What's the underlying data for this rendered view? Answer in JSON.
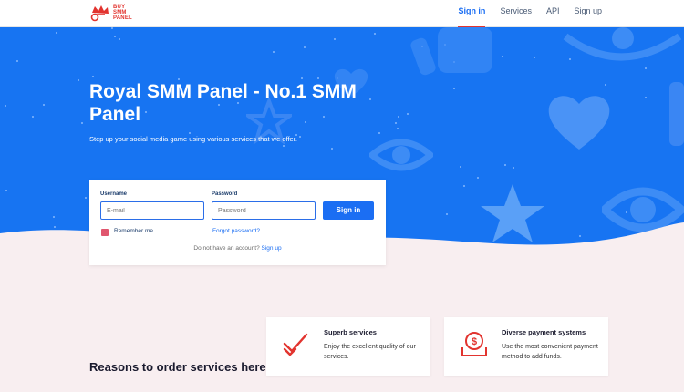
{
  "brand": {
    "logo_text": [
      "BUY",
      "SMM",
      "PANEL"
    ],
    "accent": "#e2342f"
  },
  "nav": {
    "items": [
      {
        "label": "Sign in",
        "active": true
      },
      {
        "label": "Services",
        "active": false
      },
      {
        "label": "API",
        "active": false
      },
      {
        "label": "Sign up",
        "active": false
      }
    ]
  },
  "hero": {
    "title": "Royal SMM Panel - No.1 SMM Panel",
    "subtitle": "Step up your social media game using various services that we offer.",
    "bg_color": "#1774f2"
  },
  "login": {
    "username_label": "Username",
    "username_placeholder": "E-mail",
    "password_label": "Password",
    "password_placeholder": "Password",
    "submit_label": "Sign in",
    "remember_label": "Remember me",
    "forgot_label": "Forgot password?",
    "no_account_text": "Do not have an account?",
    "signup_link": "Sign up"
  },
  "reasons": {
    "heading": "Reasons to order services here"
  },
  "features": [
    {
      "title": "Superb services",
      "desc": "Enjoy the excellent quality of our services.",
      "icon": "checkmark-icon"
    },
    {
      "title": "Diverse payment systems",
      "desc": "Use the most convenient payment method to add funds.",
      "icon": "payment-icon"
    }
  ]
}
